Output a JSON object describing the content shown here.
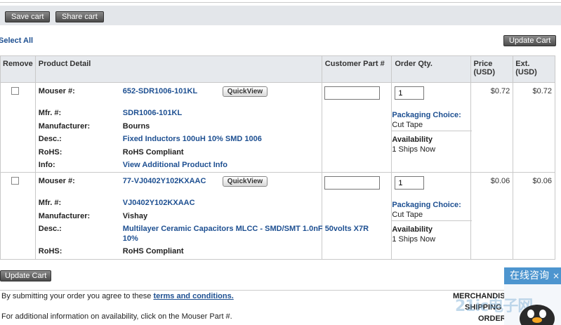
{
  "toolbar": {
    "save_cart": "Save cart",
    "share_cart": "Share cart",
    "select_all": "Select All",
    "update_cart_top": "Update Cart",
    "update_cart_bottom": "Update Cart"
  },
  "table": {
    "headers": {
      "remove": "Remove",
      "product_detail": "Product Detail",
      "customer_part": "Customer Part #",
      "order_qty": "Order Qty.",
      "price": "Price\n(USD)",
      "ext": "Ext.\n(USD)"
    },
    "labels": {
      "mouser": "Mouser #:",
      "mfr": "Mfr. #:",
      "manufacturer": "Manufacturer:",
      "desc": "Desc.:",
      "rohs": "RoHS:",
      "info": "Info:",
      "quickview": "QuickView",
      "packaging": "Packaging Choice:",
      "availability": "Availability"
    },
    "rows": [
      {
        "mouser_no": "652-SDR1006-101KL",
        "mfr_no": "SDR1006-101KL",
        "manufacturer": "Bourns",
        "desc": "Fixed Inductors 100uH 10% SMD 1006",
        "rohs": "RoHS Compliant",
        "info": "View Additional Product Info",
        "customer_part": "",
        "qty": "1",
        "packaging": "Cut Tape",
        "availability": "1 Ships Now",
        "price": "$0.72",
        "ext": "$0.72"
      },
      {
        "mouser_no": "77-VJ0402Y102KXAAC",
        "mfr_no": "VJ0402Y102KXAAC",
        "manufacturer": "Vishay",
        "desc_line1": "Multilayer Ceramic Capacitors MLCC - SMD/SMT 1.0nF 50volts X7R",
        "desc_line2": "10%",
        "rohs": "RoHS Compliant",
        "customer_part": "",
        "qty": "1",
        "packaging": "Cut Tape",
        "availability": "1 Ships Now",
        "price": "$0.06",
        "ext": "$0.06"
      }
    ]
  },
  "footer": {
    "terms_prefix": "By submitting your order you agree to these ",
    "terms_link": "terms and conditions.",
    "availability_note": "For additional information on availability, click on the Mouser Part #.",
    "merchandise": "MERCHANDISE",
    "shipping": "SHIPPING C",
    "order": "ORDER"
  },
  "chat": {
    "label": "在线咨询",
    "close": "×"
  },
  "watermark": "21ic电子网"
}
